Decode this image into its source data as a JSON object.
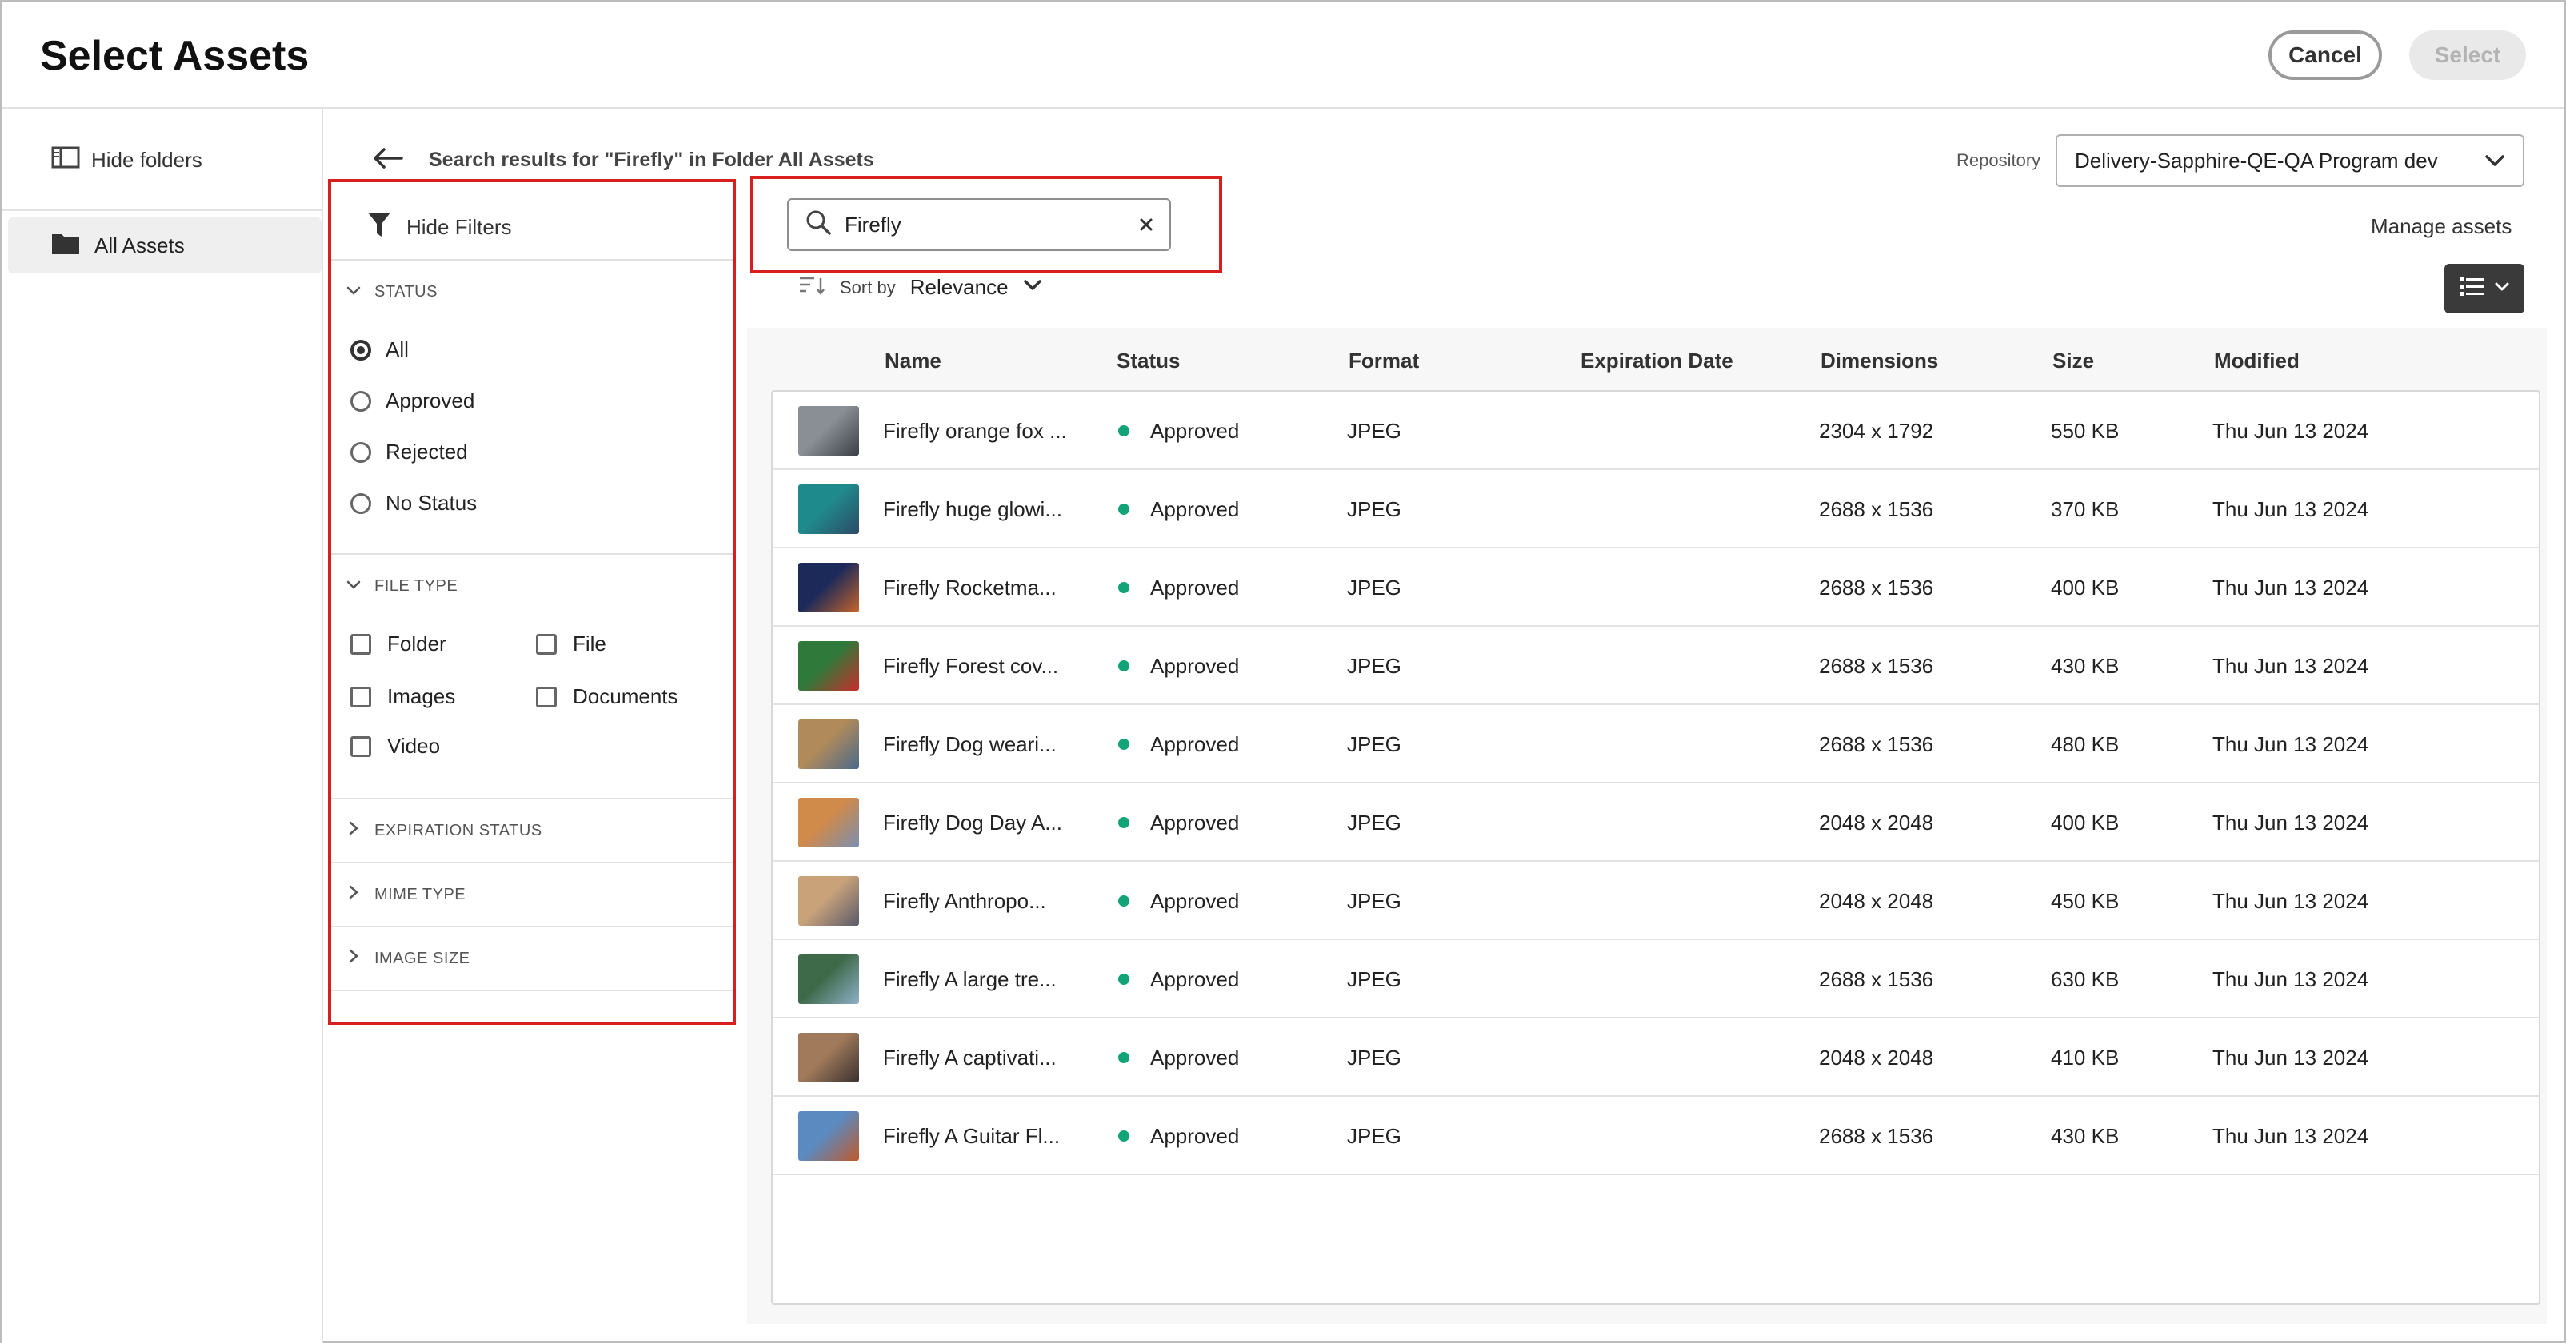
{
  "header": {
    "title": "Select Assets",
    "cancel_label": "Cancel",
    "select_label": "Select"
  },
  "sidebar": {
    "hide_folders_label": "Hide folders",
    "items": [
      {
        "label": "All Assets",
        "selected": true
      }
    ]
  },
  "toolbar": {
    "breadcrumb": "Search results for \"Firefly\" in Folder All Assets",
    "repository_label": "Repository",
    "repository_value": "Delivery-Sapphire-QE-QA Program dev",
    "manage_assets_label": "Manage assets",
    "view_icon": "list-view-icon"
  },
  "filters": {
    "hide_filters_label": "Hide Filters",
    "status": {
      "title": "STATUS",
      "options": [
        "All",
        "Approved",
        "Rejected",
        "No Status"
      ],
      "selected": "All"
    },
    "file_type": {
      "title": "FILE TYPE",
      "options": [
        "Folder",
        "File",
        "Images",
        "Documents",
        "Video"
      ]
    },
    "collapsed_sections": [
      "EXPIRATION STATUS",
      "MIME TYPE",
      "IMAGE SIZE"
    ]
  },
  "search": {
    "value": "Firefly",
    "clear_icon": "close-icon"
  },
  "sort": {
    "label": "Sort by",
    "value": "Relevance"
  },
  "table": {
    "columns": [
      "Name",
      "Status",
      "Format",
      "Expiration Date",
      "Dimensions",
      "Size",
      "Modified"
    ],
    "rows": [
      {
        "name": "Firefly orange fox ...",
        "status": "Approved",
        "format": "JPEG",
        "expiration": "",
        "dimensions": "2304 x 1792",
        "size": "550 KB",
        "modified": "Thu Jun 13 2024",
        "thumb": [
          "#8a8f96",
          "#3b3f45"
        ]
      },
      {
        "name": "Firefly huge glowi...",
        "status": "Approved",
        "format": "JPEG",
        "expiration": "",
        "dimensions": "2688 x 1536",
        "size": "370 KB",
        "modified": "Thu Jun 13 2024",
        "thumb": [
          "#1f8a8c",
          "#2e4a66"
        ]
      },
      {
        "name": "Firefly Rocketma...",
        "status": "Approved",
        "format": "JPEG",
        "expiration": "",
        "dimensions": "2688 x 1536",
        "size": "400 KB",
        "modified": "Thu Jun 13 2024",
        "thumb": [
          "#1c2a5a",
          "#c7642a"
        ]
      },
      {
        "name": "Firefly Forest cov...",
        "status": "Approved",
        "format": "JPEG",
        "expiration": "",
        "dimensions": "2688 x 1536",
        "size": "430 KB",
        "modified": "Thu Jun 13 2024",
        "thumb": [
          "#2f7a3a",
          "#c92d2d"
        ]
      },
      {
        "name": "Firefly Dog weari...",
        "status": "Approved",
        "format": "JPEG",
        "expiration": "",
        "dimensions": "2688 x 1536",
        "size": "480 KB",
        "modified": "Thu Jun 13 2024",
        "thumb": [
          "#b08a5a",
          "#4b6a8a"
        ]
      },
      {
        "name": "Firefly Dog Day A...",
        "status": "Approved",
        "format": "JPEG",
        "expiration": "",
        "dimensions": "2048 x 2048",
        "size": "400 KB",
        "modified": "Thu Jun 13 2024",
        "thumb": [
          "#d08a4a",
          "#7a8fb0"
        ]
      },
      {
        "name": "Firefly Anthropo...",
        "status": "Approved",
        "format": "JPEG",
        "expiration": "",
        "dimensions": "2048 x 2048",
        "size": "450 KB",
        "modified": "Thu Jun 13 2024",
        "thumb": [
          "#c9a27a",
          "#5a5a6a"
        ]
      },
      {
        "name": "Firefly A large tre...",
        "status": "Approved",
        "format": "JPEG",
        "expiration": "",
        "dimensions": "2688 x 1536",
        "size": "630 KB",
        "modified": "Thu Jun 13 2024",
        "thumb": [
          "#3f6a4a",
          "#8fb0c9"
        ]
      },
      {
        "name": "Firefly A captivati...",
        "status": "Approved",
        "format": "JPEG",
        "expiration": "",
        "dimensions": "2048 x 2048",
        "size": "410 KB",
        "modified": "Thu Jun 13 2024",
        "thumb": [
          "#a07a5a",
          "#3a3030"
        ]
      },
      {
        "name": "Firefly A Guitar Fl...",
        "status": "Approved",
        "format": "JPEG",
        "expiration": "",
        "dimensions": "2688 x 1536",
        "size": "430 KB",
        "modified": "Thu Jun 13 2024",
        "thumb": [
          "#5a8ac0",
          "#c05a2a"
        ]
      }
    ]
  },
  "colors": {
    "highlight": "#d7201e",
    "approved_dot": "#12a478",
    "view_toggle_bg": "#3a3a3a"
  }
}
